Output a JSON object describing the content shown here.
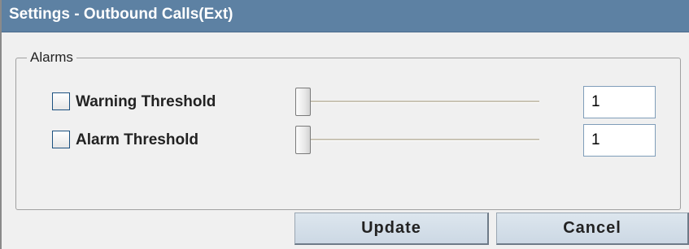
{
  "window": {
    "title": "Settings - Outbound Calls(Ext)"
  },
  "alarms": {
    "legend": "Alarms",
    "rows": [
      {
        "label": "Warning Threshold",
        "checked": false,
        "slider_value": 1,
        "value": "1"
      },
      {
        "label": "Alarm Threshold",
        "checked": false,
        "slider_value": 1,
        "value": "1"
      }
    ]
  },
  "buttons": {
    "update_label": "Update",
    "cancel_label": "Cancel"
  },
  "colors": {
    "titlebar": "#5d81a3",
    "background": "#f0f0f0",
    "button": "#ccd8e4"
  }
}
